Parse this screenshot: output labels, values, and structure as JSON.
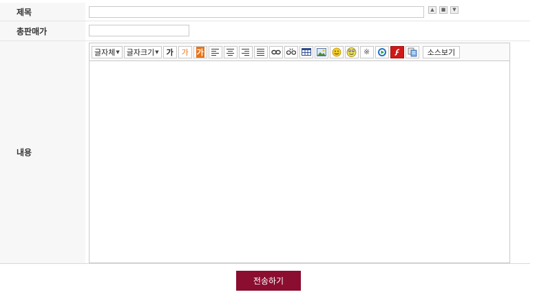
{
  "form": {
    "title_label": "제목",
    "price_label": "총판매가",
    "content_label": "내용",
    "title_value": "",
    "price_value": "",
    "submit_label": "전송하기"
  },
  "editor": {
    "font_family_label": "글자체",
    "font_size_label": "글자크기",
    "bold_glyph": "가",
    "fore_color_glyph": "가",
    "back_color_glyph": "가",
    "special_char_glyph": "※",
    "source_view_label": "소스보기",
    "icons": [
      "align-left-icon",
      "align-center-icon",
      "align-right-icon",
      "align-justify-icon",
      "link-icon",
      "unlink-icon",
      "table-icon",
      "image-icon",
      "emoticon-icon",
      "emoticon2-icon",
      "special-char-icon",
      "media-icon",
      "flash-icon",
      "paste-icon"
    ]
  },
  "colors": {
    "submit_bg": "#8b0d2f",
    "fore_color": "#e8731a",
    "back_color": "#e8731a",
    "flash": "#d01818"
  }
}
